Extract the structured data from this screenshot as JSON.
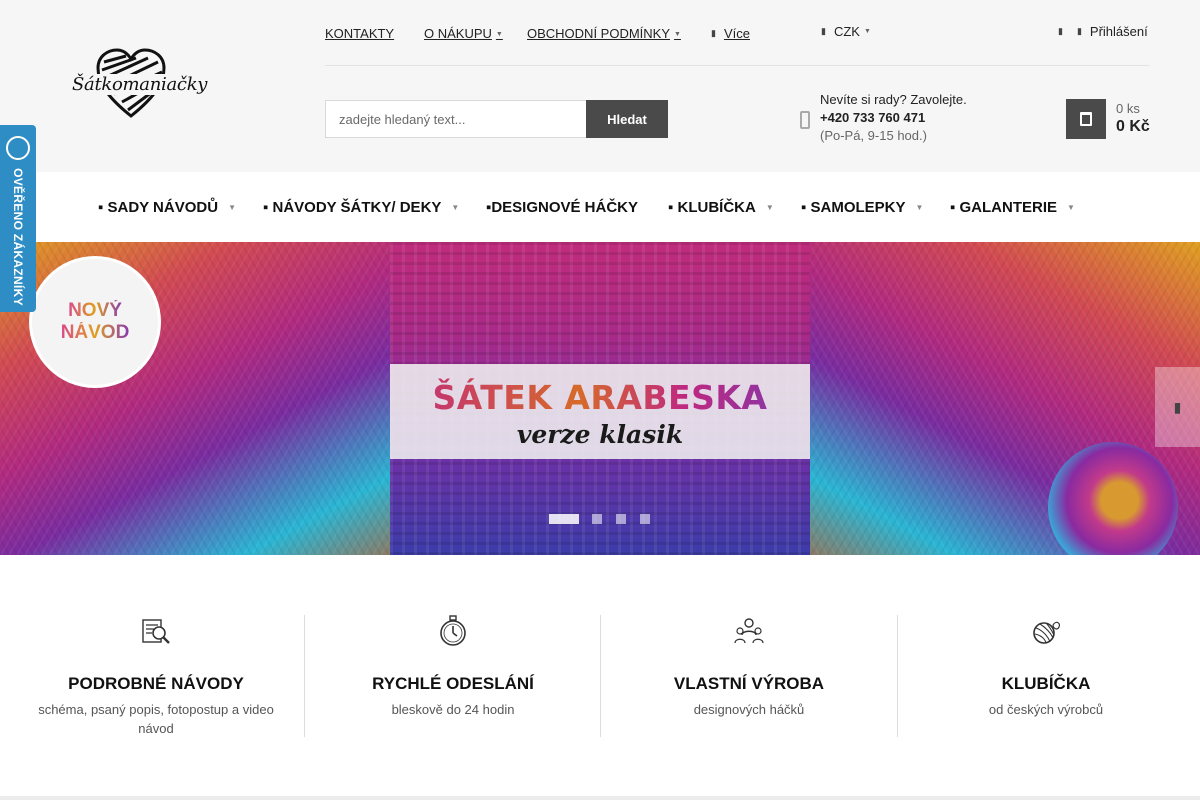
{
  "brand": {
    "name": "Šátkomaniačky"
  },
  "topnav": {
    "kontakty": "KONTAKTY",
    "o_nakupu": "O NÁKUPU",
    "obchodni_podminky": "OBCHODNÍ PODMÍNKY",
    "vice": "Více",
    "currency": "CZK",
    "login": "Přihlášení"
  },
  "search": {
    "placeholder": "zadejte hledaný text...",
    "button_label": "Hledat"
  },
  "help": {
    "title": "Nevíte si rady? Zavolejte.",
    "phone": "+420 733 760 471",
    "hours": "(Po-Pá, 9-15 hod.)"
  },
  "cart": {
    "count": "0 ks",
    "price": "0 Kč"
  },
  "menu": [
    {
      "label": "▪ SADY NÁVODŮ",
      "has_submenu": true
    },
    {
      "label": "▪ NÁVODY ŠÁTKY/ DEKY",
      "has_submenu": true
    },
    {
      "label": "▪DESIGNOVÉ HÁČKY",
      "has_submenu": false
    },
    {
      "label": "▪ KLUBÍČKA",
      "has_submenu": true
    },
    {
      "label": "▪ SAMOLEPKY",
      "has_submenu": true
    },
    {
      "label": "▪ GALANTERIE",
      "has_submenu": true
    }
  ],
  "banner": {
    "badge_line1": "NOVÝ",
    "badge_line2": "NÁVOD",
    "title": "ŠÁTEK ARABESKA",
    "subtitle": "verze klasik",
    "slides_total": 4,
    "active_slide": 1
  },
  "verified": {
    "label": "OVĚŘENO ZÁKAZNÍKY"
  },
  "benefits": [
    {
      "icon": "magnifier-pattern-icon",
      "title": "PODROBNÉ NÁVODY",
      "desc": "schéma, psaný popis, fotopostup a video návod"
    },
    {
      "icon": "stopwatch-icon",
      "title": "RYCHLÉ ODESLÁNÍ",
      "desc": "bleskově do 24 hodin"
    },
    {
      "icon": "workers-icon",
      "title": "VLASTNÍ VÝROBA",
      "desc": "designových háčků"
    },
    {
      "icon": "yarn-ball-icon",
      "title": "KLUBÍČKA",
      "desc": "od českých výrobců"
    }
  ],
  "colors": {
    "accent_dark": "#4a4a4a",
    "verified_blue": "#2d8dc4",
    "page_bg": "#f6f6f6"
  }
}
